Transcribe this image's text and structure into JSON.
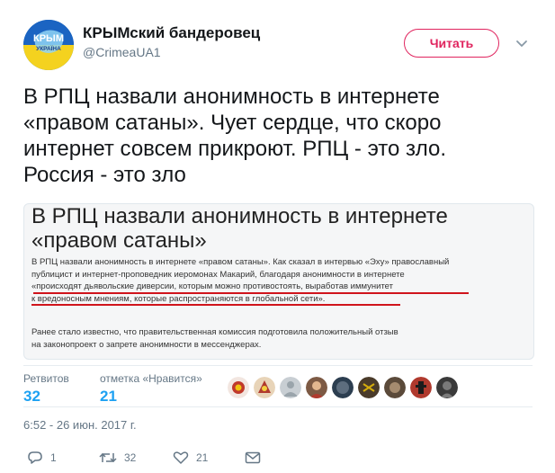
{
  "author": {
    "name": "КРЫМский бандеровец",
    "handle": "@CrimeaUA1",
    "avatar_text_top": "КРЫМ",
    "avatar_text_bottom": "УКРАЇНА"
  },
  "follow_button": {
    "label": "Читать"
  },
  "tweet": {
    "text": "В РПЦ назвали анонимность в интернете\n«правом сатаны». Чует сердце, что скоро\nинтернет совсем прикроют. РПЦ - это зло.\nРоссия - это зло"
  },
  "media": {
    "headline": "В РПЦ назвали анонимность в интернете\n«правом сатаны»",
    "paragraph1": "В РПЦ назвали анонимность в интернете «правом сатаны». Как сказал в интервью «Эху» православный\nпублицист и интернет-проповедник иеромонах Макарий, благодаря анонимности в интернете\n«происходят дьявольские диверсии, которым можно противостоять, выработав иммунитет\nк вредоносным мнениям, которые распространяются в глобальной сети».",
    "paragraph2": "Ранее стало известно, что правительственная комиссия подготовила положительный отзыв\nна законопроект о запрете анонимности в мессенджерах.",
    "underline_color": "#d0141c"
  },
  "stats": {
    "retweets_label": "Ретвитов",
    "retweets_count": "32",
    "likes_label": "отметка «Нравится»",
    "likes_count": "21"
  },
  "timestamp": "6:52 - 26 июн. 2017 г.",
  "actions": {
    "reply_count": "1",
    "retweet_count": "32",
    "like_count": "21"
  },
  "colors": {
    "accent": "#1da1f2",
    "follow": "#e0245e",
    "secondary_text": "#657786"
  },
  "icons": {
    "caret": "chevron-down-icon",
    "reply": "reply-icon",
    "retweet": "retweet-icon",
    "like": "heart-icon",
    "message": "envelope-icon"
  }
}
